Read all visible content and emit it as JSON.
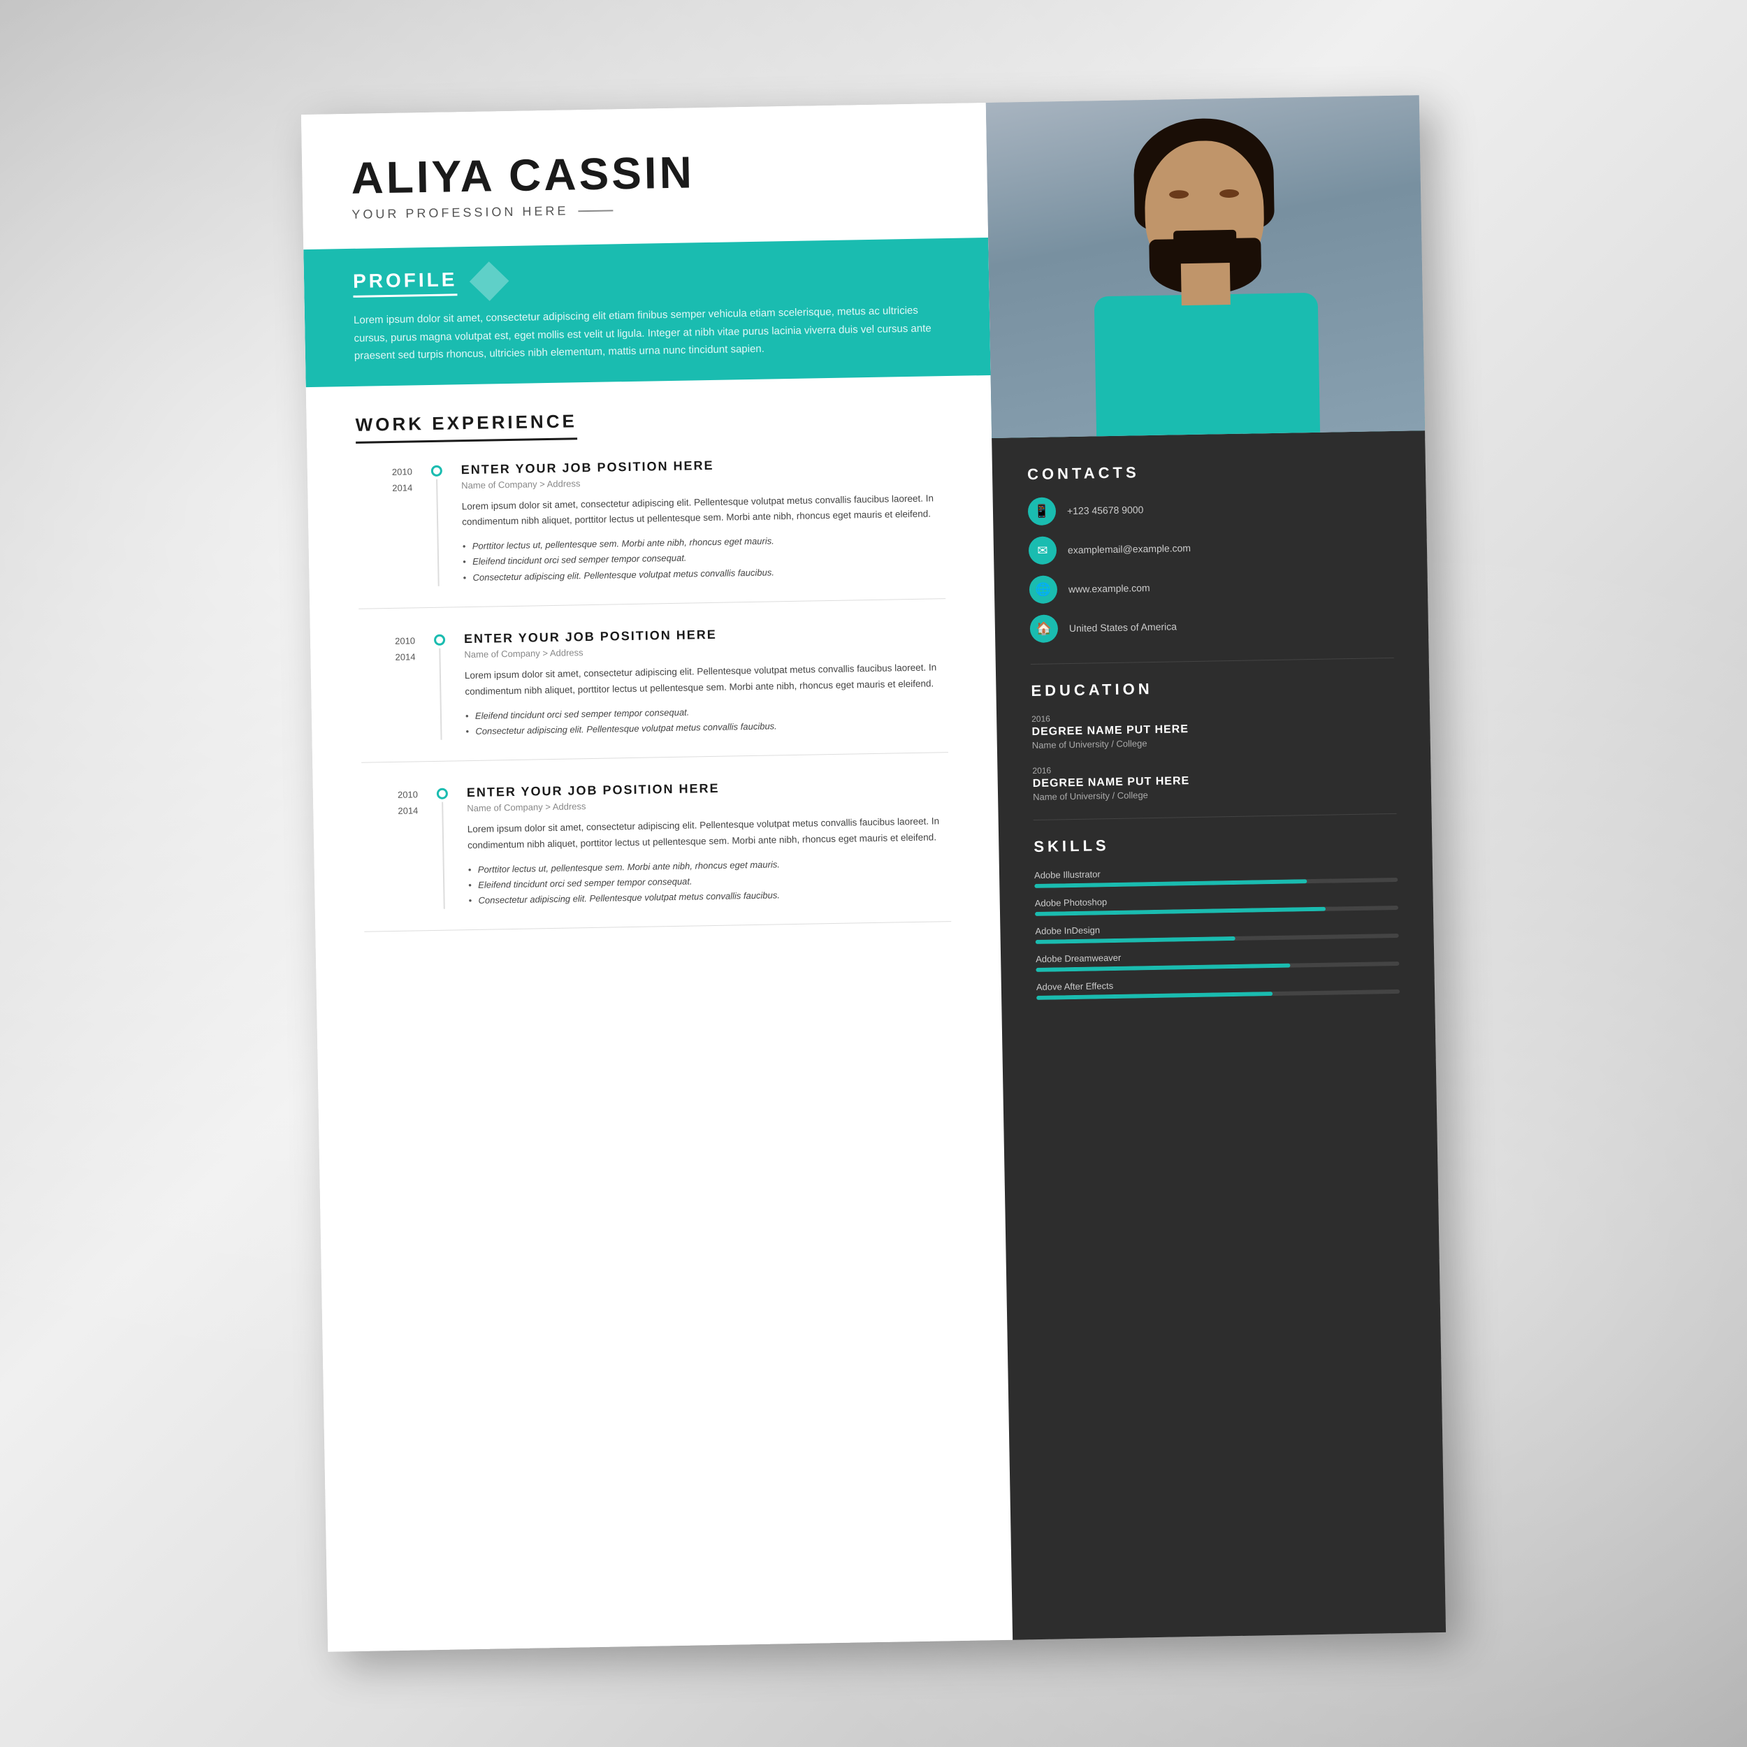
{
  "candidate": {
    "name": "ALIYA CASSIN",
    "profession": "YOUR PROFESSION HERE"
  },
  "profile": {
    "title": "PROFILE",
    "text": "Lorem ipsum dolor sit amet, consectetur adipiscing elit etiam finibus semper vehicula etiam scelerisque, metus ac ultricies cursus, purus magna volutpat est, eget mollis est velit ut ligula. Integer at nibh vitae purus lacinia viverra duis vel cursus ante praesent sed turpis rhoncus, ultricies nibh elementum, mattis urna nunc tincidunt sapien."
  },
  "workExperience": {
    "title": "WORK EXPERIENCE",
    "jobs": [
      {
        "yearStart": "2010",
        "yearEnd": "2014",
        "title": "ENTER YOUR JOB POSITION HERE",
        "company": "Name of Company > Address",
        "desc": "Lorem ipsum dolor sit amet, consectetur adipiscing elit. Pellentesque volutpat metus convallis faucibus laoreet. In condimentum nibh aliquet, porttitor lectus ut pellentesque sem. Morbi ante nibh, rhoncus eget mauris et eleifend.",
        "bullets": [
          "Porttitor lectus ut, pellentesque sem. Morbi ante nibh, rhoncus eget mauris.",
          "Eleifend tincidunt orci sed semper tempor consequat.",
          "Consectetur adipiscing elit. Pellentesque volutpat metus convallis faucibus."
        ]
      },
      {
        "yearStart": "2010",
        "yearEnd": "2014",
        "title": "ENTER YOUR JOB POSITION HERE",
        "company": "Name of Company > Address",
        "desc": "Lorem ipsum dolor sit amet, consectetur adipiscing elit. Pellentesque volutpat metus convallis faucibus laoreet. In condimentum nibh aliquet, porttitor lectus ut pellentesque sem. Morbi ante nibh, rhoncus eget mauris et eleifend.",
        "bullets": [
          "Eleifend tincidunt orci sed semper tempor consequat.",
          "Consectetur adipiscing elit. Pellentesque volutpat metus convallis faucibus."
        ]
      },
      {
        "yearStart": "2010",
        "yearEnd": "2014",
        "title": "ENTER YOUR JOB POSITION HERE",
        "company": "Name of Company > Address",
        "desc": "Lorem ipsum dolor sit amet, consectetur adipiscing elit. Pellentesque volutpat metus convallis faucibus laoreet. In condimentum nibh aliquet, porttitor lectus ut pellentesque sem. Morbi ante nibh, rhoncus eget mauris et eleifend.",
        "bullets": [
          "Porttitor lectus ut, pellentesque sem. Morbi ante nibh, rhoncus eget mauris.",
          "Eleifend tincidunt orci sed semper tempor consequat.",
          "Consectetur adipiscing elit. Pellentesque volutpat metus convallis faucibus."
        ]
      }
    ]
  },
  "contacts": {
    "title": "CONTACTS",
    "items": [
      {
        "icon": "📱",
        "text": "+123 45678 9000",
        "type": "phone"
      },
      {
        "icon": "✉",
        "text": "examplemail@example.com",
        "type": "email"
      },
      {
        "icon": "🌐",
        "text": "www.example.com",
        "type": "website"
      },
      {
        "icon": "🏠",
        "text": "United States of America",
        "type": "location"
      }
    ]
  },
  "education": {
    "title": "EDUCATION",
    "entries": [
      {
        "year": "2016",
        "degree": "DEGREE NAME PUT HERE",
        "school": "Name of University / College"
      },
      {
        "year": "2016",
        "degree": "DEGREE NAME PUT HERE",
        "school": "Name of University / College"
      }
    ]
  },
  "skills": {
    "title": "SKILLS",
    "items": [
      {
        "name": "Adobe Illustrator",
        "percent": 75
      },
      {
        "name": "Adobe Photoshop",
        "percent": 80
      },
      {
        "name": "Adobe InDesign",
        "percent": 55
      },
      {
        "name": "Adobe Dreamweaver",
        "percent": 70
      },
      {
        "name": "Adove After Effects",
        "percent": 65
      }
    ]
  },
  "colors": {
    "teal": "#1abcb0",
    "dark": "#2d2d2d",
    "white": "#ffffff"
  }
}
